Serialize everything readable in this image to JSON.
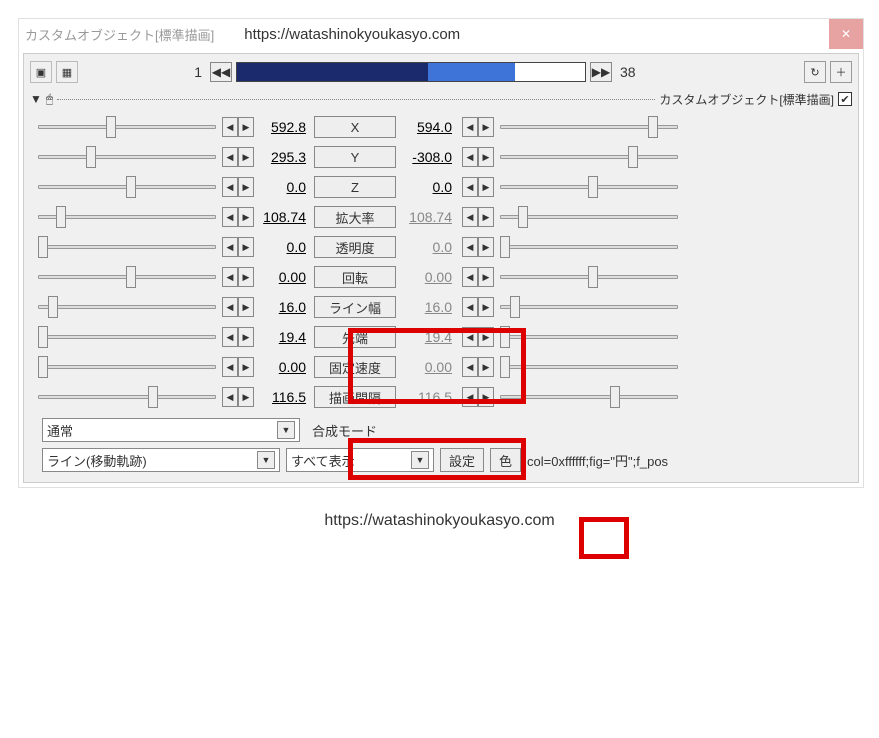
{
  "title": "カスタムオブジェクト[標準描画]",
  "url_top": "https://watashinokyoukasyo.com",
  "url_bottom": "https://watashinokyoukasyo.com",
  "frame_start": "1",
  "frame_end": "38",
  "object_label": "カスタムオブジェクト[標準描画]",
  "params": [
    {
      "label": "X",
      "l": "592.8",
      "r": "594.0",
      "rGrey": false,
      "lpos": 68,
      "rpos": 148
    },
    {
      "label": "Y",
      "l": "295.3",
      "r": "-308.0",
      "rGrey": false,
      "lpos": 48,
      "rpos": 128
    },
    {
      "label": "Z",
      "l": "0.0",
      "r": "0.0",
      "rGrey": false,
      "lpos": 88,
      "rpos": 88
    },
    {
      "label": "拡大率",
      "l": "108.74",
      "r": "108.74",
      "rGrey": true,
      "lpos": 18,
      "rpos": 18
    },
    {
      "label": "透明度",
      "l": "0.0",
      "r": "0.0",
      "rGrey": true,
      "lpos": 0,
      "rpos": 0
    },
    {
      "label": "回転",
      "l": "0.00",
      "r": "0.00",
      "rGrey": true,
      "lpos": 88,
      "rpos": 88
    },
    {
      "label": "ライン幅",
      "l": "16.0",
      "r": "16.0",
      "rGrey": true,
      "lpos": 10,
      "rpos": 10
    },
    {
      "label": "先端",
      "l": "19.4",
      "r": "19.4",
      "rGrey": true,
      "lpos": 0,
      "rpos": 0
    },
    {
      "label": "固定速度",
      "l": "0.00",
      "r": "0.00",
      "rGrey": true,
      "lpos": 0,
      "rpos": 0
    },
    {
      "label": "描画間隔",
      "l": "116.5",
      "r": "116.5",
      "rGrey": true,
      "lpos": 110,
      "rpos": 110
    }
  ],
  "blend_mode_combo": "通常",
  "blend_mode_label": "合成モード",
  "effect_combo": "ライン(移動軌跡)",
  "display_combo": "すべて表示",
  "settings_btn": "設定",
  "color_btn": "色",
  "code_text": "col=0xffffff;fig=\"円\";f_pos"
}
